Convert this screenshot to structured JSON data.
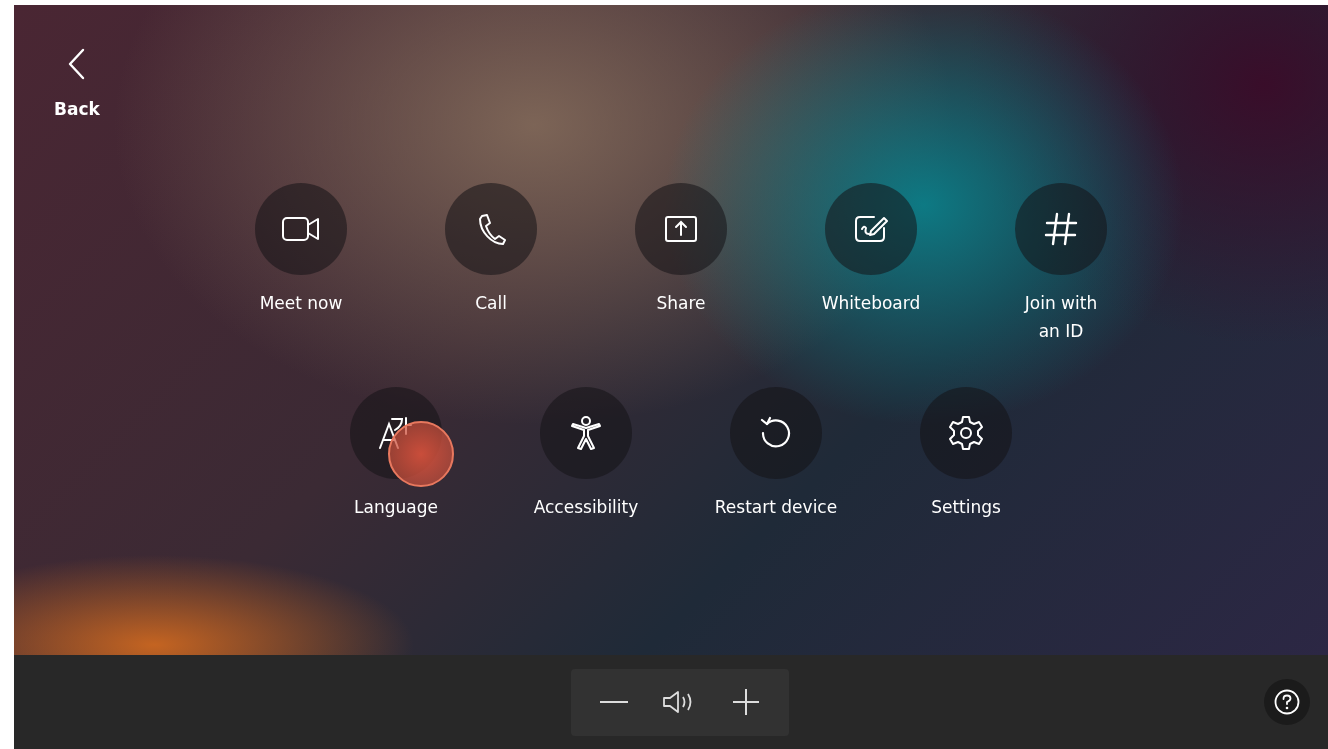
{
  "back": {
    "label": "Back"
  },
  "rows": [
    [
      {
        "kind": "video",
        "lines": [
          "Meet now"
        ]
      },
      {
        "kind": "phone",
        "lines": [
          "Call"
        ]
      },
      {
        "kind": "share",
        "lines": [
          "Share"
        ]
      },
      {
        "kind": "whiteboard",
        "lines": [
          "Whiteboard"
        ]
      },
      {
        "kind": "hash",
        "lines": [
          "Join with",
          "an ID"
        ]
      }
    ],
    [
      {
        "kind": "language",
        "lines": [
          "Language"
        ]
      },
      {
        "kind": "accessibility",
        "lines": [
          "Accessibility"
        ]
      },
      {
        "kind": "restart",
        "lines": [
          "Restart device"
        ]
      },
      {
        "kind": "settings",
        "lines": [
          "Settings"
        ]
      }
    ]
  ]
}
